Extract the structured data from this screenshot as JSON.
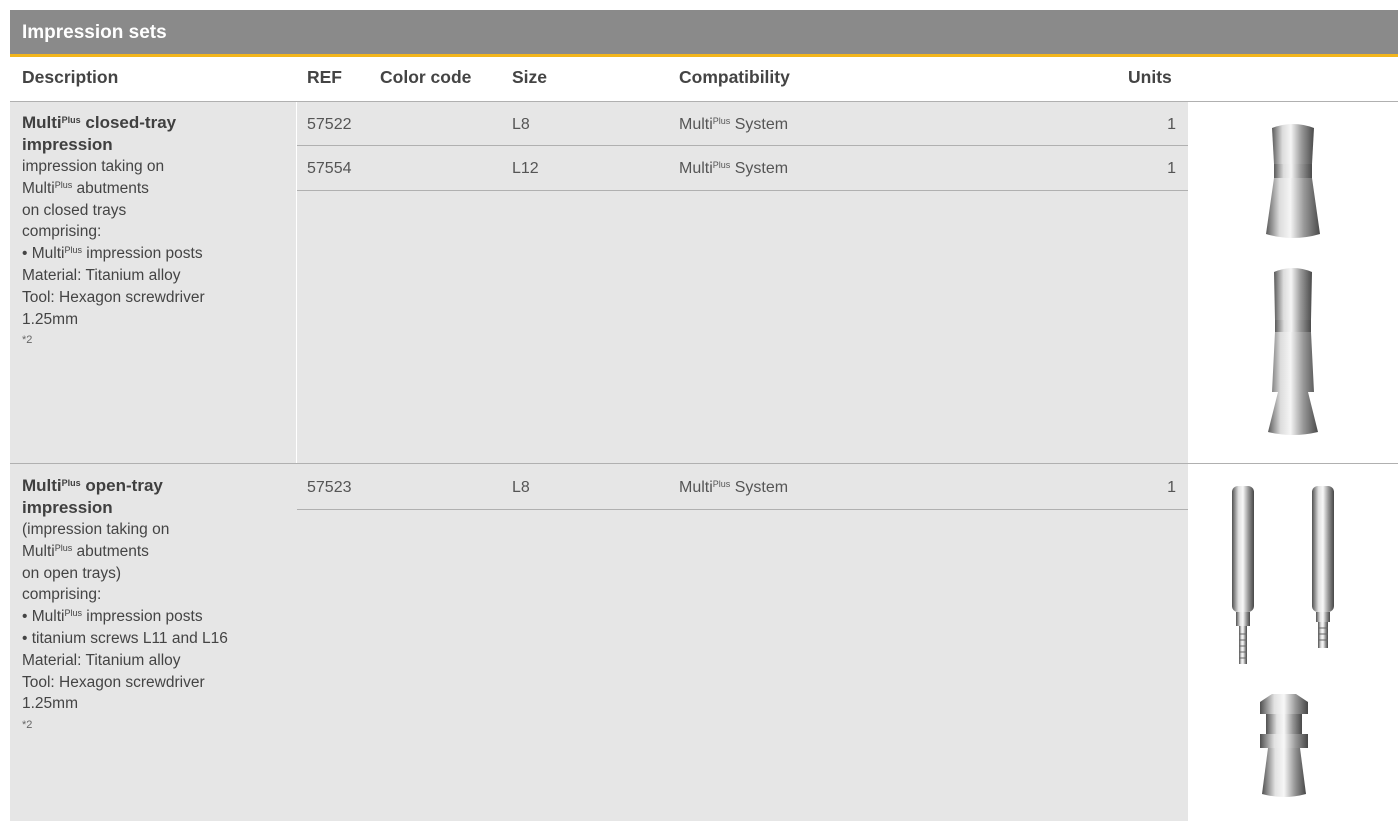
{
  "section": {
    "title": "Impression sets"
  },
  "columns": {
    "description": "Description",
    "ref": "REF",
    "color_code": "Color code",
    "size": "Size",
    "compatibility": "Compatibility",
    "units": "Units"
  },
  "colors": {
    "banner": "#8a8a8a",
    "accent": "#f2b51c",
    "row_shade": "#e6e6e6"
  },
  "products": [
    {
      "title_main": "Multi",
      "title_sup": "Plus",
      "title_rest": " closed-tray",
      "title_line2": "impression",
      "desc": {
        "l1": "impression taking on",
        "l2_main": "Multi",
        "l2_sup": "Plus",
        "l2_rest": " abutments",
        "l3": "on closed trays",
        "l4": "comprising:",
        "l5_pre": "• Multi",
        "l5_sup": "Plus",
        "l5_rest": " impression posts",
        "l6": "Material: Titanium alloy",
        "l7": "Tool: Hexagon screwdriver",
        "l8": "1.25mm",
        "foot": "*2"
      },
      "items": [
        {
          "ref": "57522",
          "color_code": "",
          "size": "L8",
          "compat_main": "Multi",
          "compat_sup": "Plus",
          "compat_rest": " System",
          "units": "1"
        },
        {
          "ref": "57554",
          "color_code": "",
          "size": "L12",
          "compat_main": "Multi",
          "compat_sup": "Plus",
          "compat_rest": " System",
          "units": "1"
        }
      ],
      "image_icon": "closed-tray-impression-post-image"
    },
    {
      "title_main": "Multi",
      "title_sup": "Plus",
      "title_rest": " open-tray",
      "title_line2": "impression",
      "desc": {
        "l1": "(impression taking on",
        "l2_main": "Multi",
        "l2_sup": "Plus",
        "l2_rest": " abutments",
        "l3": "on open trays)",
        "l4": "comprising:",
        "l5_pre": "• Multi",
        "l5_sup": "Plus",
        "l5_rest": " impression posts",
        "l5b": "• titanium screws L11 and L16",
        "l6": "Material: Titanium alloy",
        "l7": "Tool: Hexagon screwdriver",
        "l8": "1.25mm",
        "foot": "*2"
      },
      "items": [
        {
          "ref": "57523",
          "color_code": "",
          "size": "L8",
          "compat_main": "Multi",
          "compat_sup": "Plus",
          "compat_rest": " System",
          "units": "1"
        }
      ],
      "image_icon": "open-tray-impression-post-image"
    }
  ]
}
